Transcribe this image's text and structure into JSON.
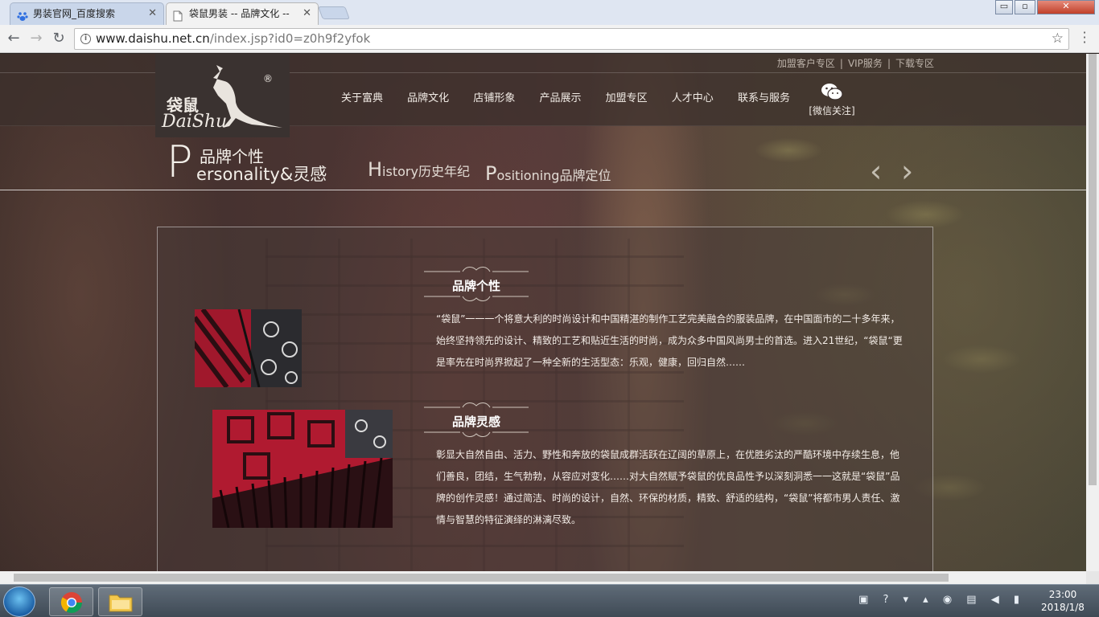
{
  "browser": {
    "tabs": [
      {
        "title": "男装官网_百度搜索",
        "close": "✕"
      },
      {
        "title": "袋鼠男装 -- 品牌文化 --",
        "close": "✕"
      }
    ],
    "url_host": "www.daishu.net.cn",
    "url_path": "/index.jsp?id0=z0h9f2yfok",
    "window_controls": {
      "minimize": "▭",
      "restore": "▫",
      "close": "✕"
    }
  },
  "site": {
    "top_links": [
      "加盟客户专区",
      "|",
      "VIP服务",
      "|",
      "下载专区"
    ],
    "logo": {
      "chinese": "袋鼠",
      "latin": "DaiShu",
      "registered": "®"
    },
    "nav": [
      "关于富典",
      "品牌文化",
      "店铺形象",
      "产品展示",
      "加盟专区",
      "人才中心",
      "联系与服务"
    ],
    "wechat_label": "[微信关注]",
    "subnav": {
      "p_letter": "P",
      "p_top": "品牌个性",
      "p_bottom": "ersonality&灵感",
      "history_first": "H",
      "history_rest": "istory历史年纪",
      "positioning_first": "P",
      "positioning_rest": "ositioning品牌定位",
      "prev_arrow": "‹",
      "next_arrow": "›"
    },
    "sections": [
      {
        "title": "品牌个性",
        "text": "“袋鼠”一一一个将意大利的时尚设计和中国精湛的制作工艺完美融合的服装品牌，在中国面市的二十多年来，始终坚持领先的设计、精致的工艺和贴近生活的时尚，成为众多中国风尚男士的首选。进入21世纪，“袋鼠“更是率先在时尚界掀起了一种全新的生活型态：乐观，健康，回归自然……"
      },
      {
        "title": "品牌灵感",
        "text": "彰显大自然自由、活力、野性和奔放的袋鼠成群活跃在辽阔的草原上，在优胜劣汰的严酷环境中存续生息，他们善良，团结，生气勃勃，从容应对变化……对大自然赋予袋鼠的优良品性予以深刻洞悉一一这就是“袋鼠”品牌的创作灵感！通过简洁、时尚的设计，自然、环保的材质，精致、舒适的结构，“袋鼠”将都市男人责任、激情与智慧的特征演绎的淋漓尽致。"
      }
    ]
  },
  "taskbar": {
    "time": "23:00",
    "date": "2018/1/8",
    "tray_icons": [
      "network-icon",
      "help-icon",
      "flag-icon",
      "qq-icon",
      "device-icon",
      "volume-icon",
      "signal-icon"
    ]
  },
  "colors": {
    "accent_text": "#f3ece6",
    "chrome_bg": "#f2f2f2",
    "tab_bg": "#c9d6ea"
  }
}
